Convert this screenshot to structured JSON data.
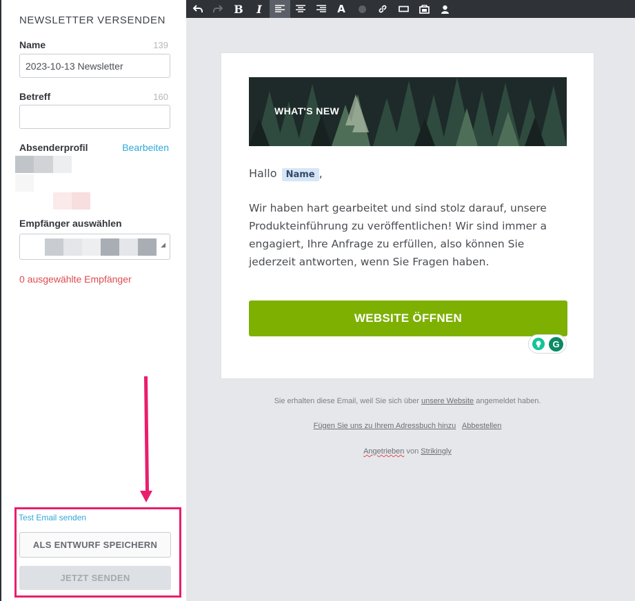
{
  "sidebar": {
    "title": "NEWSLETTER VERSENDEN",
    "name_label": "Name",
    "name_counter": "139",
    "name_value": "2023-10-13 Newsletter",
    "subject_label": "Betreff",
    "subject_counter": "160",
    "subject_value": "",
    "sender_label": "Absenderprofil",
    "sender_edit": "Bearbeiten",
    "recipients_label": "Empfänger auswählen",
    "recipients_selected": "0 ausgewählte Empfänger",
    "test_email": "Test Email senden",
    "save_draft": "ALS ENTWURF SPEICHERN",
    "send_now": "JETZT SENDEN"
  },
  "toolbar": {
    "buttons": [
      "undo-icon",
      "redo-icon",
      "bold-icon",
      "italic-icon",
      "align-left-icon",
      "align-center-icon",
      "align-right-icon",
      "font-color-icon",
      "highlight-color-icon",
      "link-icon",
      "button-icon",
      "image-icon",
      "merge-tag-icon"
    ],
    "bold": "B",
    "italic": "I",
    "font_color": "A"
  },
  "email": {
    "banner_text": "WHAT'S NEW",
    "greeting_prefix": "Hallo",
    "merge_tag": "Name",
    "greeting_suffix": ",",
    "body": "Wir haben hart gearbeitet und sind stolz darauf, unsere Produkteinführung zu veröffentlichen! Wir sind immer a engagiert, Ihre Anfrage zu erfüllen, also können Sie jederzeit antworten, wenn Sie Fragen haben.",
    "cta": "WEBSITE ÖFFNEN",
    "grammarly_g": "G"
  },
  "footer": {
    "line1_prefix": "Sie erhalten diese Email, weil Sie sich über",
    "line1_link": "unsere Website",
    "line1_suffix": "angemeldet haben.",
    "addressbook": "Fügen Sie uns zu Ihrem Adressbuch hinzu",
    "unsubscribe": "Abbestellen",
    "powered_prefix": "Angetrieben",
    "powered_mid": "von",
    "powered_link": "Strikingly"
  },
  "colors": {
    "accent_link": "#2ea8d8",
    "error": "#e0494f",
    "highlight": "#ea1d6d",
    "cta": "#7db000",
    "toolbar": "#2f3237"
  }
}
